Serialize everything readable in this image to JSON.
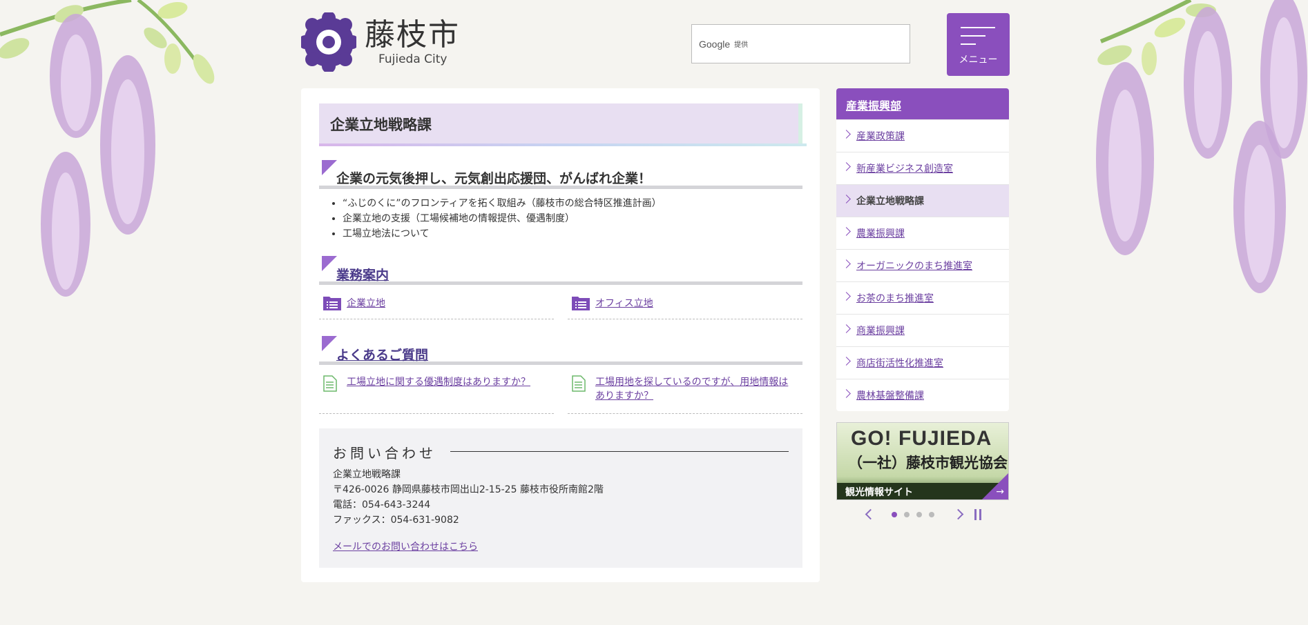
{
  "colors": {
    "accent": "#8a4fbd",
    "title_bg": "#e8dff2",
    "link": "#6b3fa0"
  },
  "header": {
    "logo_jp": "藤枝市",
    "logo_en": "Fujieda City",
    "search": {
      "google": "Google",
      "provided": "提供"
    },
    "menu_label": "メニュー"
  },
  "main": {
    "title": "企業立地戦略課",
    "section1": {
      "heading": "企業の元気後押し、元気創出応援団、がんばれ企業！",
      "items": [
        "“ふじのくに”のフロンティアを拓く取組み（藤枝市の総合特区推進計画）",
        "企業立地の支援（工場候補地の情報提供、優遇制度）",
        "工場立地法について"
      ]
    },
    "section2": {
      "heading": "業務案内",
      "links": [
        "企業立地",
        "オフィス立地"
      ]
    },
    "section3": {
      "heading": "よくあるご質問",
      "links": [
        "工場立地に関する優遇制度はありますか？",
        "工場用地を探しているのですが、用地情報はありますか？"
      ]
    },
    "contact": {
      "heading": "お問い合わせ",
      "dept": "企業立地戦略課",
      "address": "〒426-0026 静岡県藤枝市岡出山2-15-25 藤枝市役所南館2階",
      "phone": "電話：054-643-3244",
      "fax": "ファックス：054-631-9082",
      "mail_link": "メールでのお問い合わせはこちら"
    }
  },
  "sidebar": {
    "heading": "産業振興部",
    "items": [
      {
        "label": "産業政策課",
        "active": false
      },
      {
        "label": "新産業ビジネス創造室",
        "active": false
      },
      {
        "label": "企業立地戦略課",
        "active": true
      },
      {
        "label": "農業振興課",
        "active": false
      },
      {
        "label": "オーガニックのまち推進室",
        "active": false
      },
      {
        "label": "お茶のまち推進室",
        "active": false
      },
      {
        "label": "商業振興課",
        "active": false
      },
      {
        "label": "商店街活性化推進室",
        "active": false
      },
      {
        "label": "農林基盤整備課",
        "active": false
      }
    ]
  },
  "banner": {
    "go": "GO! FUJIEDA",
    "org": "（一社）藤枝市観光協会",
    "bar": "観光情報サイト"
  },
  "slider": {
    "dot_count": 4,
    "active_dot": 1
  }
}
